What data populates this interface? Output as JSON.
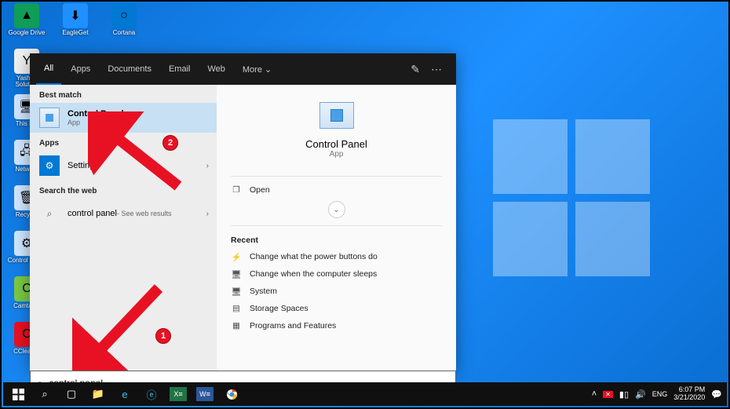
{
  "desktop_icons_col1": [
    {
      "label": "Google Drive",
      "glyph": "▲",
      "color": "#0f9d58"
    },
    {
      "label": "Yashns Solution",
      "glyph": "Y",
      "color": "#f0f0f0"
    },
    {
      "label": "This PC",
      "glyph": "🖥",
      "color": "#d0e7ff"
    },
    {
      "label": "Network",
      "glyph": "🖧",
      "color": "#d0e7ff"
    },
    {
      "label": "Recycle",
      "glyph": "🗑",
      "color": "#d0e7ff"
    },
    {
      "label": "Control Panel",
      "glyph": "⚙",
      "color": "#d0e7ff"
    },
    {
      "label": "Camtasia",
      "glyph": "C",
      "color": "#7ac943"
    },
    {
      "label": "CCleaner",
      "glyph": "C",
      "color": "#e81123"
    }
  ],
  "desktop_icons_col2": [
    {
      "label": "EagleGet",
      "glyph": "⬇",
      "color": "#1e90ff"
    }
  ],
  "desktop_icons_col3": [
    {
      "label": "Cortana",
      "glyph": "○",
      "color": "#0078d4"
    }
  ],
  "tabs": [
    "All",
    "Apps",
    "Documents",
    "Email",
    "Web",
    "More ⌄"
  ],
  "active_tab_index": 0,
  "sections": {
    "best_match": "Best match",
    "apps": "Apps",
    "search_web": "Search the web"
  },
  "best_match": {
    "title": "Control Panel",
    "sub": "App"
  },
  "apps_result": {
    "title": "Settings"
  },
  "web_result": {
    "title": "control panel",
    "sub": " - See web results"
  },
  "details": {
    "title": "Control Panel",
    "sub": "App",
    "open": "Open",
    "recent_hdr": "Recent",
    "recent": [
      "Change what the power buttons do",
      "Change when the computer sleeps",
      "System",
      "Storage Spaces",
      "Programs and Features"
    ]
  },
  "search_value": "control panel",
  "annotations": {
    "one": "1",
    "two": "2"
  },
  "tray": {
    "lang": "ENG",
    "time": "6:07 PM",
    "date": "3/21/2020"
  }
}
